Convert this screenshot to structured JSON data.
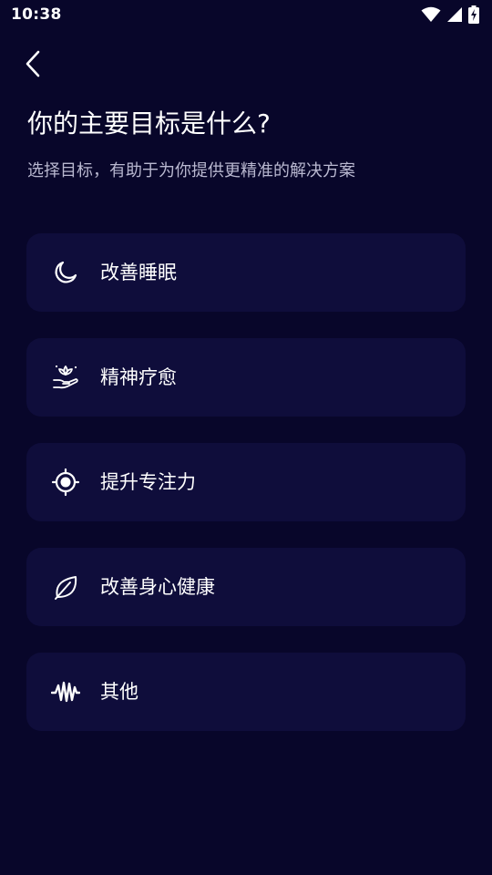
{
  "status_bar": {
    "time": "10:38",
    "icons": [
      "wifi-icon",
      "signal-icon",
      "battery-charging-icon"
    ]
  },
  "header": {
    "back_icon": "chevron-left-icon",
    "title": "你的主要目标是什么?",
    "subtitle": "选择目标，有助于为你提供更精准的解决方案"
  },
  "goals": [
    {
      "label": "改善睡眠",
      "icon": "moon-icon"
    },
    {
      "label": "精神疗愈",
      "icon": "lotus-hand-icon"
    },
    {
      "label": "提升专注力",
      "icon": "target-icon"
    },
    {
      "label": "改善身心健康",
      "icon": "leaf-icon"
    },
    {
      "label": "其他",
      "icon": "waveform-icon"
    }
  ],
  "colors": {
    "background": "#08062a",
    "card": "#0f0d3b",
    "text": "#ffffff",
    "subtitle": "#b9b8d0"
  }
}
